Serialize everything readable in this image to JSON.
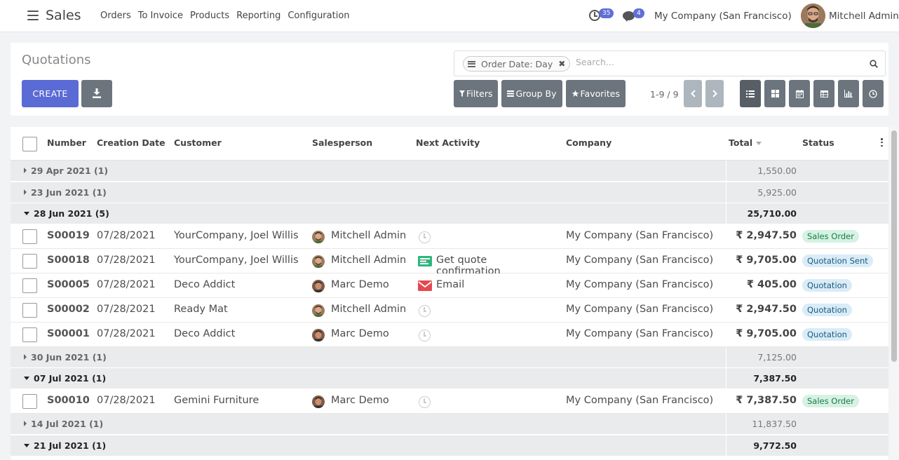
{
  "nav": {
    "app_name": "Sales",
    "menu": [
      "Orders",
      "To Invoice",
      "Products",
      "Reporting",
      "Configuration"
    ],
    "activity_count": "35",
    "message_count": "4",
    "company": "My Company (San Francisco)",
    "user": "Mitchell Admin"
  },
  "control": {
    "breadcrumb": "Quotations",
    "create_label": "CREATE",
    "facet_label": "Order Date: Day",
    "search_placeholder": "Search...",
    "filters_label": "Filters",
    "groupby_label": "Group By",
    "favorites_label": "Favorites",
    "pager": "1-9 / 9"
  },
  "columns": {
    "number": "Number",
    "creation_date": "Creation Date",
    "customer": "Customer",
    "salesperson": "Salesperson",
    "next_activity": "Next Activity",
    "company": "Company",
    "total": "Total",
    "status": "Status"
  },
  "groups": [
    {
      "label": "29 Apr 2021 (1)",
      "total": "1,550.00",
      "open": false
    },
    {
      "label": "23 Jun 2021 (1)",
      "total": "5,925.00",
      "open": false
    },
    {
      "label": "28 Jun 2021 (5)",
      "total": "25,710.00",
      "open": true
    },
    {
      "label": "30 Jun 2021 (1)",
      "total": "7,125.00",
      "open": false
    },
    {
      "label": "07 Jul 2021 (1)",
      "total": "7,387.50",
      "open": true
    },
    {
      "label": "14 Jul 2021 (1)",
      "total": "11,837.50",
      "open": false
    },
    {
      "label": "21 Jul 2021 (1)",
      "total": "9,772.50",
      "open": true
    }
  ],
  "rows": [
    {
      "number": "S00019",
      "date": "07/28/2021",
      "customer": "YourCompany, Joel Willis",
      "salesperson": "Mitchell Admin",
      "activity": "",
      "activity_type": "clock",
      "company": "My Company (San Francisco)",
      "total": "₹ 2,947.50",
      "status": "Sales Order",
      "status_type": "success"
    },
    {
      "number": "S00018",
      "date": "07/28/2021",
      "customer": "YourCompany, Joel Willis",
      "salesperson": "Mitchell Admin",
      "activity": "Get quote confirmation",
      "activity_type": "todo",
      "company": "My Company (San Francisco)",
      "total": "₹ 9,705.00",
      "status": "Quotation Sent",
      "status_type": "info"
    },
    {
      "number": "S00005",
      "date": "07/28/2021",
      "customer": "Deco Addict",
      "salesperson": "Marc Demo",
      "activity": "Email",
      "activity_type": "email",
      "company": "My Company (San Francisco)",
      "total": "₹ 405.00",
      "status": "Quotation",
      "status_type": "info"
    },
    {
      "number": "S00002",
      "date": "07/28/2021",
      "customer": "Ready Mat",
      "salesperson": "Mitchell Admin",
      "activity": "",
      "activity_type": "clock",
      "company": "My Company (San Francisco)",
      "total": "₹ 2,947.50",
      "status": "Quotation",
      "status_type": "info"
    },
    {
      "number": "S00001",
      "date": "07/28/2021",
      "customer": "Deco Addict",
      "salesperson": "Marc Demo",
      "activity": "",
      "activity_type": "clock",
      "company": "My Company (San Francisco)",
      "total": "₹ 9,705.00",
      "status": "Quotation",
      "status_type": "info"
    },
    {
      "number": "S00010",
      "date": "07/28/2021",
      "customer": "Gemini Furniture",
      "salesperson": "Marc Demo",
      "activity": "",
      "activity_type": "clock",
      "company": "My Company (San Francisco)",
      "total": "₹ 7,387.50",
      "status": "Sales Order",
      "status_type": "success"
    }
  ]
}
